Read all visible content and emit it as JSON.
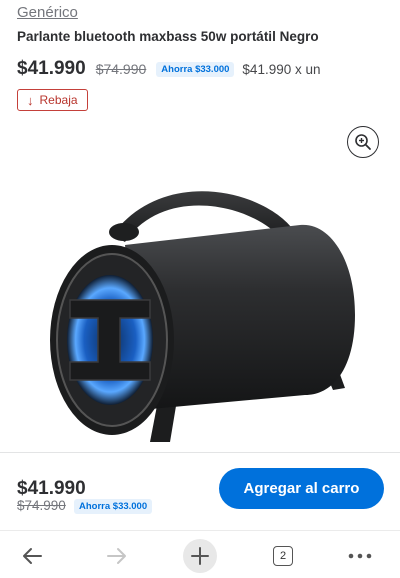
{
  "product": {
    "brand": "Genérico",
    "title": "Parlante bluetooth maxbass 50w portátil Negro",
    "price": "$41.990",
    "old_price": "$74.990",
    "savings": "Ahorra $33.000",
    "unit_price": "$41.990 x un",
    "rebaja_label": "Rebaja"
  },
  "icons": {
    "rebaja": "down-arrow-icon",
    "zoom": "zoom-in-icon",
    "back": "back-arrow-icon",
    "forward": "forward-arrow-icon",
    "new_tab": "plus-icon",
    "tabs": "tabs-count-icon",
    "menu": "more-dots-icon"
  },
  "cart_bar": {
    "price": "$41.990",
    "old_price": "$74.990",
    "savings": "Ahorra $33.000",
    "button_label": "Agregar al carro"
  },
  "browser_nav": {
    "tab_count": "2"
  },
  "colors": {
    "accent": "#0071dc",
    "rebaja": "#c4403a",
    "badge_bg": "#e6f1fc"
  }
}
